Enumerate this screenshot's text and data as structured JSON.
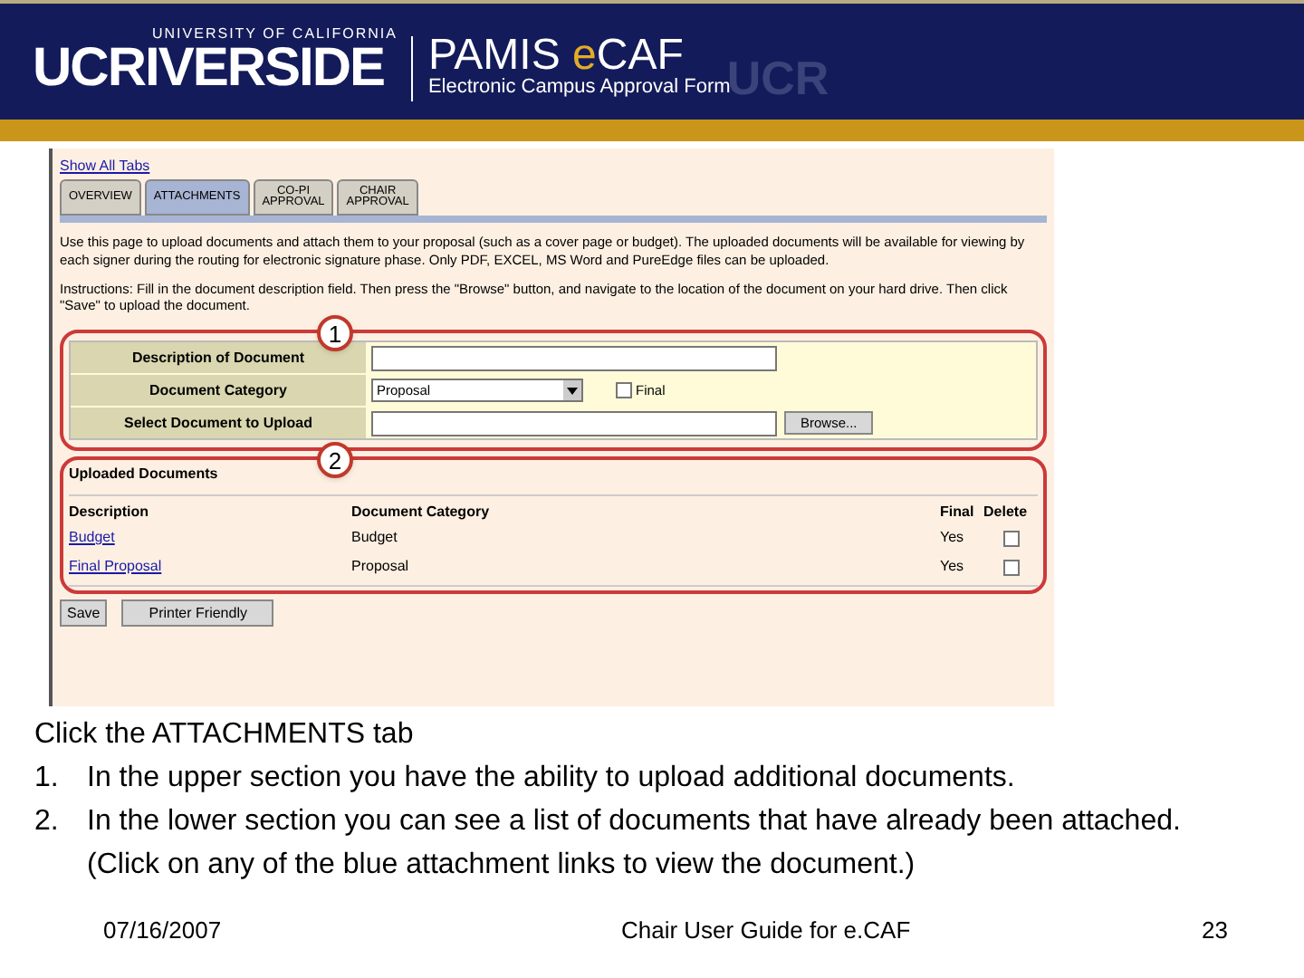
{
  "banner": {
    "university_top": "UNIVERSITY OF CALIFORNIA",
    "university": "UCRIVERSIDE",
    "app_name_1": "PAMIS ",
    "app_name_e": "e",
    "app_name_2": "CAF",
    "app_subtitle": "Electronic Campus Approval Form",
    "watermark": "UCR"
  },
  "screenshot": {
    "show_all_tabs": "Show All Tabs",
    "tabs": [
      {
        "lines": [
          "OVERVIEW"
        ],
        "selected": false
      },
      {
        "lines": [
          "ATTACHMENTS"
        ],
        "selected": true
      },
      {
        "lines": [
          "CO-PI",
          "APPROVAL"
        ],
        "selected": false
      },
      {
        "lines": [
          "CHAIR",
          "APPROVAL"
        ],
        "selected": false
      }
    ],
    "intro": "Use this page to upload documents and attach them to your proposal (such as a cover page or budget). The uploaded documents will be available for viewing by each signer during the routing for electronic signature phase. Only PDF, EXCEL, MS Word and PureEdge files can be uploaded.",
    "instructions": "Instructions: Fill in the document description field. Then press the \"Browse\" button, and navigate to the location of the document on your hard drive. Then click \"Save\" to upload the document.",
    "callout_1": "1",
    "callout_2": "2",
    "form": {
      "description_label": "Description of Document",
      "category_label": "Document Category",
      "category_value": "Proposal",
      "final_label": "Final",
      "final_checked": false,
      "upload_label": "Select Document to Upload",
      "browse_button": "Browse..."
    },
    "uploaded": {
      "title": "Uploaded Documents",
      "columns": [
        "Description",
        "Document Category",
        "Final",
        "Delete"
      ],
      "rows": [
        {
          "description": "Budget",
          "category": "Budget",
          "final": "Yes",
          "delete_checked": false
        },
        {
          "description": "Final Proposal",
          "category": "Proposal",
          "final": "Yes",
          "delete_checked": false
        }
      ]
    },
    "buttons": [
      "Save",
      "Printer Friendly"
    ]
  },
  "caption": {
    "lead": "Click the ATTACHMENTS tab",
    "items": [
      {
        "number": "1.",
        "text": "In the upper section you have the ability to upload additional documents."
      },
      {
        "number": "2.",
        "text": "In the lower section you can see a list of documents that have already been attached. (Click on any of the blue attachment links to view the document.)"
      }
    ]
  },
  "footer": {
    "date": "07/16/2007",
    "title": "Chair User Guide for e.CAF",
    "page": "23"
  }
}
